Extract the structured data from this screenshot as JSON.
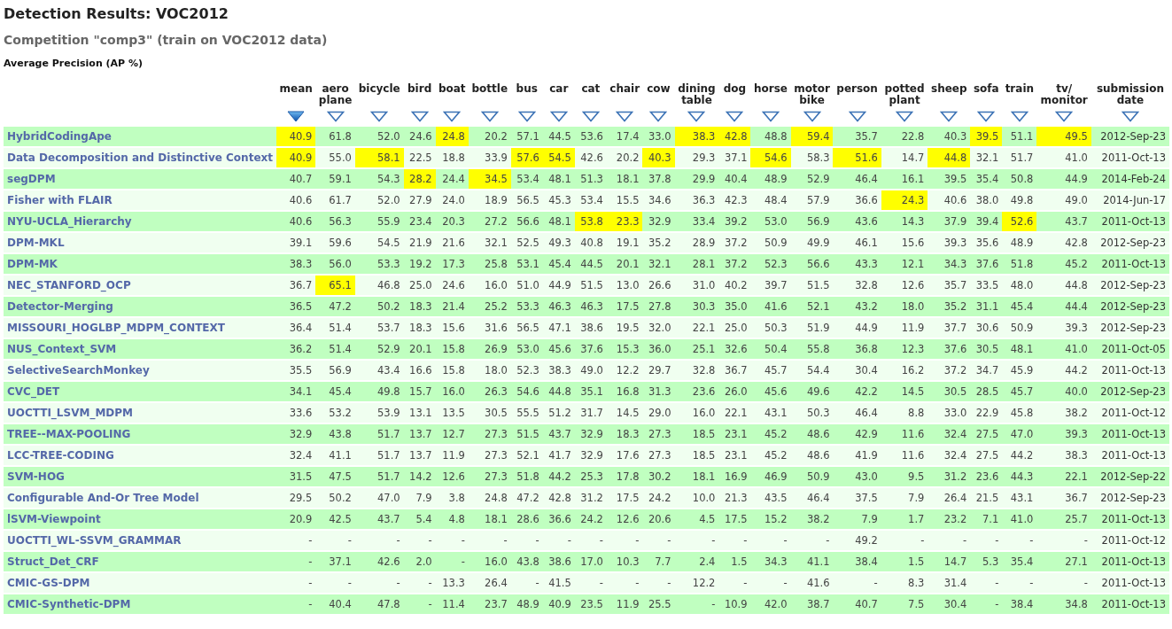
{
  "title": "Detection Results: VOC2012",
  "subtitle": "Competition \"comp3\" (train on VOC2012 data)",
  "section": "Average Precision (AP %)",
  "columns": [
    {
      "label": "mean",
      "sorted": true
    },
    {
      "label": "aero plane",
      "sorted": false
    },
    {
      "label": "bicycle",
      "sorted": false
    },
    {
      "label": "bird",
      "sorted": false
    },
    {
      "label": "boat",
      "sorted": false
    },
    {
      "label": "bottle",
      "sorted": false
    },
    {
      "label": "bus",
      "sorted": false
    },
    {
      "label": "car",
      "sorted": false
    },
    {
      "label": "cat",
      "sorted": false
    },
    {
      "label": "chair",
      "sorted": false
    },
    {
      "label": "cow",
      "sorted": false
    },
    {
      "label": "dining table",
      "sorted": false
    },
    {
      "label": "dog",
      "sorted": false
    },
    {
      "label": "horse",
      "sorted": false
    },
    {
      "label": "motor bike",
      "sorted": false
    },
    {
      "label": "person",
      "sorted": false
    },
    {
      "label": "potted plant",
      "sorted": false
    },
    {
      "label": "sheep",
      "sorted": false
    },
    {
      "label": "sofa",
      "sorted": false
    },
    {
      "label": "train",
      "sorted": false
    },
    {
      "label": "tv/ monitor",
      "sorted": false
    },
    {
      "label": "submission date",
      "sorted": false
    }
  ],
  "rows": [
    {
      "name": "HybridCodingApe",
      "date": "2012-Sep-23",
      "cells": [
        {
          "value": "40.9",
          "best": true
        },
        {
          "value": "61.8",
          "best": false
        },
        {
          "value": "52.0",
          "best": false
        },
        {
          "value": "24.6",
          "best": false
        },
        {
          "value": "24.8",
          "best": true
        },
        {
          "value": "20.2",
          "best": false
        },
        {
          "value": "57.1",
          "best": false
        },
        {
          "value": "44.5",
          "best": false
        },
        {
          "value": "53.6",
          "best": false
        },
        {
          "value": "17.4",
          "best": false
        },
        {
          "value": "33.0",
          "best": false
        },
        {
          "value": "38.3",
          "best": true
        },
        {
          "value": "42.8",
          "best": true
        },
        {
          "value": "48.8",
          "best": false
        },
        {
          "value": "59.4",
          "best": true
        },
        {
          "value": "35.7",
          "best": false
        },
        {
          "value": "22.8",
          "best": false
        },
        {
          "value": "40.3",
          "best": false
        },
        {
          "value": "39.5",
          "best": true
        },
        {
          "value": "51.1",
          "best": false
        },
        {
          "value": "49.5",
          "best": true
        }
      ]
    },
    {
      "name": "Data Decomposition and Distinctive Context",
      "date": "2011-Oct-13",
      "cells": [
        {
          "value": "40.9",
          "best": true
        },
        {
          "value": "55.0",
          "best": false
        },
        {
          "value": "58.1",
          "best": true
        },
        {
          "value": "22.5",
          "best": false
        },
        {
          "value": "18.8",
          "best": false
        },
        {
          "value": "33.9",
          "best": false
        },
        {
          "value": "57.6",
          "best": true
        },
        {
          "value": "54.5",
          "best": true
        },
        {
          "value": "42.6",
          "best": false
        },
        {
          "value": "20.2",
          "best": false
        },
        {
          "value": "40.3",
          "best": true
        },
        {
          "value": "29.3",
          "best": false
        },
        {
          "value": "37.1",
          "best": false
        },
        {
          "value": "54.6",
          "best": true
        },
        {
          "value": "58.3",
          "best": false
        },
        {
          "value": "51.6",
          "best": true
        },
        {
          "value": "14.7",
          "best": false
        },
        {
          "value": "44.8",
          "best": true
        },
        {
          "value": "32.1",
          "best": false
        },
        {
          "value": "51.7",
          "best": false
        },
        {
          "value": "41.0",
          "best": false
        }
      ]
    },
    {
      "name": "segDPM",
      "date": "2014-Feb-24",
      "cells": [
        {
          "value": "40.7",
          "best": false
        },
        {
          "value": "59.1",
          "best": false
        },
        {
          "value": "54.3",
          "best": false
        },
        {
          "value": "28.2",
          "best": true
        },
        {
          "value": "24.4",
          "best": false
        },
        {
          "value": "34.5",
          "best": true
        },
        {
          "value": "53.4",
          "best": false
        },
        {
          "value": "48.1",
          "best": false
        },
        {
          "value": "51.3",
          "best": false
        },
        {
          "value": "18.1",
          "best": false
        },
        {
          "value": "37.8",
          "best": false
        },
        {
          "value": "29.9",
          "best": false
        },
        {
          "value": "40.4",
          "best": false
        },
        {
          "value": "48.9",
          "best": false
        },
        {
          "value": "52.9",
          "best": false
        },
        {
          "value": "46.4",
          "best": false
        },
        {
          "value": "16.1",
          "best": false
        },
        {
          "value": "39.5",
          "best": false
        },
        {
          "value": "35.4",
          "best": false
        },
        {
          "value": "50.8",
          "best": false
        },
        {
          "value": "44.9",
          "best": false
        }
      ]
    },
    {
      "name": "Fisher with FLAIR",
      "date": "2014-Jun-17",
      "cells": [
        {
          "value": "40.6",
          "best": false
        },
        {
          "value": "61.7",
          "best": false
        },
        {
          "value": "52.0",
          "best": false
        },
        {
          "value": "27.9",
          "best": false
        },
        {
          "value": "24.0",
          "best": false
        },
        {
          "value": "18.9",
          "best": false
        },
        {
          "value": "56.5",
          "best": false
        },
        {
          "value": "45.3",
          "best": false
        },
        {
          "value": "53.4",
          "best": false
        },
        {
          "value": "15.5",
          "best": false
        },
        {
          "value": "34.6",
          "best": false
        },
        {
          "value": "36.3",
          "best": false
        },
        {
          "value": "42.3",
          "best": false
        },
        {
          "value": "48.4",
          "best": false
        },
        {
          "value": "57.9",
          "best": false
        },
        {
          "value": "36.6",
          "best": false
        },
        {
          "value": "24.3",
          "best": true
        },
        {
          "value": "40.6",
          "best": false
        },
        {
          "value": "38.0",
          "best": false
        },
        {
          "value": "49.8",
          "best": false
        },
        {
          "value": "49.0",
          "best": false
        }
      ]
    },
    {
      "name": "NYU-UCLA_Hierarchy",
      "date": "2011-Oct-13",
      "cells": [
        {
          "value": "40.6",
          "best": false
        },
        {
          "value": "56.3",
          "best": false
        },
        {
          "value": "55.9",
          "best": false
        },
        {
          "value": "23.4",
          "best": false
        },
        {
          "value": "20.3",
          "best": false
        },
        {
          "value": "27.2",
          "best": false
        },
        {
          "value": "56.6",
          "best": false
        },
        {
          "value": "48.1",
          "best": false
        },
        {
          "value": "53.8",
          "best": true
        },
        {
          "value": "23.3",
          "best": true
        },
        {
          "value": "32.9",
          "best": false
        },
        {
          "value": "33.4",
          "best": false
        },
        {
          "value": "39.2",
          "best": false
        },
        {
          "value": "53.0",
          "best": false
        },
        {
          "value": "56.9",
          "best": false
        },
        {
          "value": "43.6",
          "best": false
        },
        {
          "value": "14.3",
          "best": false
        },
        {
          "value": "37.9",
          "best": false
        },
        {
          "value": "39.4",
          "best": false
        },
        {
          "value": "52.6",
          "best": true
        },
        {
          "value": "43.7",
          "best": false
        }
      ]
    },
    {
      "name": "DPM-MKL",
      "date": "2012-Sep-23",
      "cells": [
        {
          "value": "39.1",
          "best": false
        },
        {
          "value": "59.6",
          "best": false
        },
        {
          "value": "54.5",
          "best": false
        },
        {
          "value": "21.9",
          "best": false
        },
        {
          "value": "21.6",
          "best": false
        },
        {
          "value": "32.1",
          "best": false
        },
        {
          "value": "52.5",
          "best": false
        },
        {
          "value": "49.3",
          "best": false
        },
        {
          "value": "40.8",
          "best": false
        },
        {
          "value": "19.1",
          "best": false
        },
        {
          "value": "35.2",
          "best": false
        },
        {
          "value": "28.9",
          "best": false
        },
        {
          "value": "37.2",
          "best": false
        },
        {
          "value": "50.9",
          "best": false
        },
        {
          "value": "49.9",
          "best": false
        },
        {
          "value": "46.1",
          "best": false
        },
        {
          "value": "15.6",
          "best": false
        },
        {
          "value": "39.3",
          "best": false
        },
        {
          "value": "35.6",
          "best": false
        },
        {
          "value": "48.9",
          "best": false
        },
        {
          "value": "42.8",
          "best": false
        }
      ]
    },
    {
      "name": "DPM-MK",
      "date": "2011-Oct-13",
      "cells": [
        {
          "value": "38.3",
          "best": false
        },
        {
          "value": "56.0",
          "best": false
        },
        {
          "value": "53.3",
          "best": false
        },
        {
          "value": "19.2",
          "best": false
        },
        {
          "value": "17.3",
          "best": false
        },
        {
          "value": "25.8",
          "best": false
        },
        {
          "value": "53.1",
          "best": false
        },
        {
          "value": "45.4",
          "best": false
        },
        {
          "value": "44.5",
          "best": false
        },
        {
          "value": "20.1",
          "best": false
        },
        {
          "value": "32.1",
          "best": false
        },
        {
          "value": "28.1",
          "best": false
        },
        {
          "value": "37.2",
          "best": false
        },
        {
          "value": "52.3",
          "best": false
        },
        {
          "value": "56.6",
          "best": false
        },
        {
          "value": "43.3",
          "best": false
        },
        {
          "value": "12.1",
          "best": false
        },
        {
          "value": "34.3",
          "best": false
        },
        {
          "value": "37.6",
          "best": false
        },
        {
          "value": "51.8",
          "best": false
        },
        {
          "value": "45.2",
          "best": false
        }
      ]
    },
    {
      "name": "NEC_STANFORD_OCP",
      "date": "2012-Sep-23",
      "cells": [
        {
          "value": "36.7",
          "best": false
        },
        {
          "value": "65.1",
          "best": true
        },
        {
          "value": "46.8",
          "best": false
        },
        {
          "value": "25.0",
          "best": false
        },
        {
          "value": "24.6",
          "best": false
        },
        {
          "value": "16.0",
          "best": false
        },
        {
          "value": "51.0",
          "best": false
        },
        {
          "value": "44.9",
          "best": false
        },
        {
          "value": "51.5",
          "best": false
        },
        {
          "value": "13.0",
          "best": false
        },
        {
          "value": "26.6",
          "best": false
        },
        {
          "value": "31.0",
          "best": false
        },
        {
          "value": "40.2",
          "best": false
        },
        {
          "value": "39.7",
          "best": false
        },
        {
          "value": "51.5",
          "best": false
        },
        {
          "value": "32.8",
          "best": false
        },
        {
          "value": "12.6",
          "best": false
        },
        {
          "value": "35.7",
          "best": false
        },
        {
          "value": "33.5",
          "best": false
        },
        {
          "value": "48.0",
          "best": false
        },
        {
          "value": "44.8",
          "best": false
        }
      ]
    },
    {
      "name": "Detector-Merging",
      "date": "2012-Sep-23",
      "cells": [
        {
          "value": "36.5",
          "best": false
        },
        {
          "value": "47.2",
          "best": false
        },
        {
          "value": "50.2",
          "best": false
        },
        {
          "value": "18.3",
          "best": false
        },
        {
          "value": "21.4",
          "best": false
        },
        {
          "value": "25.2",
          "best": false
        },
        {
          "value": "53.3",
          "best": false
        },
        {
          "value": "46.3",
          "best": false
        },
        {
          "value": "46.3",
          "best": false
        },
        {
          "value": "17.5",
          "best": false
        },
        {
          "value": "27.8",
          "best": false
        },
        {
          "value": "30.3",
          "best": false
        },
        {
          "value": "35.0",
          "best": false
        },
        {
          "value": "41.6",
          "best": false
        },
        {
          "value": "52.1",
          "best": false
        },
        {
          "value": "43.2",
          "best": false
        },
        {
          "value": "18.0",
          "best": false
        },
        {
          "value": "35.2",
          "best": false
        },
        {
          "value": "31.1",
          "best": false
        },
        {
          "value": "45.4",
          "best": false
        },
        {
          "value": "44.4",
          "best": false
        }
      ]
    },
    {
      "name": "MISSOURI_HOGLBP_MDPM_CONTEXT",
      "date": "2012-Sep-23",
      "cells": [
        {
          "value": "36.4",
          "best": false
        },
        {
          "value": "51.4",
          "best": false
        },
        {
          "value": "53.7",
          "best": false
        },
        {
          "value": "18.3",
          "best": false
        },
        {
          "value": "15.6",
          "best": false
        },
        {
          "value": "31.6",
          "best": false
        },
        {
          "value": "56.5",
          "best": false
        },
        {
          "value": "47.1",
          "best": false
        },
        {
          "value": "38.6",
          "best": false
        },
        {
          "value": "19.5",
          "best": false
        },
        {
          "value": "32.0",
          "best": false
        },
        {
          "value": "22.1",
          "best": false
        },
        {
          "value": "25.0",
          "best": false
        },
        {
          "value": "50.3",
          "best": false
        },
        {
          "value": "51.9",
          "best": false
        },
        {
          "value": "44.9",
          "best": false
        },
        {
          "value": "11.9",
          "best": false
        },
        {
          "value": "37.7",
          "best": false
        },
        {
          "value": "30.6",
          "best": false
        },
        {
          "value": "50.9",
          "best": false
        },
        {
          "value": "39.3",
          "best": false
        }
      ]
    },
    {
      "name": "NUS_Context_SVM",
      "date": "2011-Oct-05",
      "cells": [
        {
          "value": "36.2",
          "best": false
        },
        {
          "value": "51.4",
          "best": false
        },
        {
          "value": "52.9",
          "best": false
        },
        {
          "value": "20.1",
          "best": false
        },
        {
          "value": "15.8",
          "best": false
        },
        {
          "value": "26.9",
          "best": false
        },
        {
          "value": "53.0",
          "best": false
        },
        {
          "value": "45.6",
          "best": false
        },
        {
          "value": "37.6",
          "best": false
        },
        {
          "value": "15.3",
          "best": false
        },
        {
          "value": "36.0",
          "best": false
        },
        {
          "value": "25.1",
          "best": false
        },
        {
          "value": "32.6",
          "best": false
        },
        {
          "value": "50.4",
          "best": false
        },
        {
          "value": "55.8",
          "best": false
        },
        {
          "value": "36.8",
          "best": false
        },
        {
          "value": "12.3",
          "best": false
        },
        {
          "value": "37.6",
          "best": false
        },
        {
          "value": "30.5",
          "best": false
        },
        {
          "value": "48.1",
          "best": false
        },
        {
          "value": "41.0",
          "best": false
        }
      ]
    },
    {
      "name": "SelectiveSearchMonkey",
      "date": "2011-Oct-13",
      "cells": [
        {
          "value": "35.5",
          "best": false
        },
        {
          "value": "56.9",
          "best": false
        },
        {
          "value": "43.4",
          "best": false
        },
        {
          "value": "16.6",
          "best": false
        },
        {
          "value": "15.8",
          "best": false
        },
        {
          "value": "18.0",
          "best": false
        },
        {
          "value": "52.3",
          "best": false
        },
        {
          "value": "38.3",
          "best": false
        },
        {
          "value": "49.0",
          "best": false
        },
        {
          "value": "12.2",
          "best": false
        },
        {
          "value": "29.7",
          "best": false
        },
        {
          "value": "32.8",
          "best": false
        },
        {
          "value": "36.7",
          "best": false
        },
        {
          "value": "45.7",
          "best": false
        },
        {
          "value": "54.4",
          "best": false
        },
        {
          "value": "30.4",
          "best": false
        },
        {
          "value": "16.2",
          "best": false
        },
        {
          "value": "37.2",
          "best": false
        },
        {
          "value": "34.7",
          "best": false
        },
        {
          "value": "45.9",
          "best": false
        },
        {
          "value": "44.2",
          "best": false
        }
      ]
    },
    {
      "name": "CVC_DET",
      "date": "2012-Sep-23",
      "cells": [
        {
          "value": "34.1",
          "best": false
        },
        {
          "value": "45.4",
          "best": false
        },
        {
          "value": "49.8",
          "best": false
        },
        {
          "value": "15.7",
          "best": false
        },
        {
          "value": "16.0",
          "best": false
        },
        {
          "value": "26.3",
          "best": false
        },
        {
          "value": "54.6",
          "best": false
        },
        {
          "value": "44.8",
          "best": false
        },
        {
          "value": "35.1",
          "best": false
        },
        {
          "value": "16.8",
          "best": false
        },
        {
          "value": "31.3",
          "best": false
        },
        {
          "value": "23.6",
          "best": false
        },
        {
          "value": "26.0",
          "best": false
        },
        {
          "value": "45.6",
          "best": false
        },
        {
          "value": "49.6",
          "best": false
        },
        {
          "value": "42.2",
          "best": false
        },
        {
          "value": "14.5",
          "best": false
        },
        {
          "value": "30.5",
          "best": false
        },
        {
          "value": "28.5",
          "best": false
        },
        {
          "value": "45.7",
          "best": false
        },
        {
          "value": "40.0",
          "best": false
        }
      ]
    },
    {
      "name": "UOCTTI_LSVM_MDPM",
      "date": "2011-Oct-12",
      "cells": [
        {
          "value": "33.6",
          "best": false
        },
        {
          "value": "53.2",
          "best": false
        },
        {
          "value": "53.9",
          "best": false
        },
        {
          "value": "13.1",
          "best": false
        },
        {
          "value": "13.5",
          "best": false
        },
        {
          "value": "30.5",
          "best": false
        },
        {
          "value": "55.5",
          "best": false
        },
        {
          "value": "51.2",
          "best": false
        },
        {
          "value": "31.7",
          "best": false
        },
        {
          "value": "14.5",
          "best": false
        },
        {
          "value": "29.0",
          "best": false
        },
        {
          "value": "16.0",
          "best": false
        },
        {
          "value": "22.1",
          "best": false
        },
        {
          "value": "43.1",
          "best": false
        },
        {
          "value": "50.3",
          "best": false
        },
        {
          "value": "46.4",
          "best": false
        },
        {
          "value": "8.8",
          "best": false
        },
        {
          "value": "33.0",
          "best": false
        },
        {
          "value": "22.9",
          "best": false
        },
        {
          "value": "45.8",
          "best": false
        },
        {
          "value": "38.2",
          "best": false
        }
      ]
    },
    {
      "name": "TREE--MAX-POOLING",
      "date": "2011-Oct-13",
      "cells": [
        {
          "value": "32.9",
          "best": false
        },
        {
          "value": "43.8",
          "best": false
        },
        {
          "value": "51.7",
          "best": false
        },
        {
          "value": "13.7",
          "best": false
        },
        {
          "value": "12.7",
          "best": false
        },
        {
          "value": "27.3",
          "best": false
        },
        {
          "value": "51.5",
          "best": false
        },
        {
          "value": "43.7",
          "best": false
        },
        {
          "value": "32.9",
          "best": false
        },
        {
          "value": "18.3",
          "best": false
        },
        {
          "value": "27.3",
          "best": false
        },
        {
          "value": "18.5",
          "best": false
        },
        {
          "value": "23.1",
          "best": false
        },
        {
          "value": "45.2",
          "best": false
        },
        {
          "value": "48.6",
          "best": false
        },
        {
          "value": "42.9",
          "best": false
        },
        {
          "value": "11.6",
          "best": false
        },
        {
          "value": "32.4",
          "best": false
        },
        {
          "value": "27.5",
          "best": false
        },
        {
          "value": "47.0",
          "best": false
        },
        {
          "value": "39.3",
          "best": false
        }
      ]
    },
    {
      "name": "LCC-TREE-CODING",
      "date": "2011-Oct-13",
      "cells": [
        {
          "value": "32.4",
          "best": false
        },
        {
          "value": "41.1",
          "best": false
        },
        {
          "value": "51.7",
          "best": false
        },
        {
          "value": "13.7",
          "best": false
        },
        {
          "value": "11.9",
          "best": false
        },
        {
          "value": "27.3",
          "best": false
        },
        {
          "value": "52.1",
          "best": false
        },
        {
          "value": "41.7",
          "best": false
        },
        {
          "value": "32.9",
          "best": false
        },
        {
          "value": "17.6",
          "best": false
        },
        {
          "value": "27.3",
          "best": false
        },
        {
          "value": "18.5",
          "best": false
        },
        {
          "value": "23.1",
          "best": false
        },
        {
          "value": "45.2",
          "best": false
        },
        {
          "value": "48.6",
          "best": false
        },
        {
          "value": "41.9",
          "best": false
        },
        {
          "value": "11.6",
          "best": false
        },
        {
          "value": "32.4",
          "best": false
        },
        {
          "value": "27.5",
          "best": false
        },
        {
          "value": "44.2",
          "best": false
        },
        {
          "value": "38.3",
          "best": false
        }
      ]
    },
    {
      "name": "SVM-HOG",
      "date": "2012-Sep-22",
      "cells": [
        {
          "value": "31.5",
          "best": false
        },
        {
          "value": "47.5",
          "best": false
        },
        {
          "value": "51.7",
          "best": false
        },
        {
          "value": "14.2",
          "best": false
        },
        {
          "value": "12.6",
          "best": false
        },
        {
          "value": "27.3",
          "best": false
        },
        {
          "value": "51.8",
          "best": false
        },
        {
          "value": "44.2",
          "best": false
        },
        {
          "value": "25.3",
          "best": false
        },
        {
          "value": "17.8",
          "best": false
        },
        {
          "value": "30.2",
          "best": false
        },
        {
          "value": "18.1",
          "best": false
        },
        {
          "value": "16.9",
          "best": false
        },
        {
          "value": "46.9",
          "best": false
        },
        {
          "value": "50.9",
          "best": false
        },
        {
          "value": "43.0",
          "best": false
        },
        {
          "value": "9.5",
          "best": false
        },
        {
          "value": "31.2",
          "best": false
        },
        {
          "value": "23.6",
          "best": false
        },
        {
          "value": "44.3",
          "best": false
        },
        {
          "value": "22.1",
          "best": false
        }
      ]
    },
    {
      "name": "Configurable And-Or Tree Model",
      "date": "2012-Sep-23",
      "cells": [
        {
          "value": "29.5",
          "best": false
        },
        {
          "value": "50.2",
          "best": false
        },
        {
          "value": "47.0",
          "best": false
        },
        {
          "value": "7.9",
          "best": false
        },
        {
          "value": "3.8",
          "best": false
        },
        {
          "value": "24.8",
          "best": false
        },
        {
          "value": "47.2",
          "best": false
        },
        {
          "value": "42.8",
          "best": false
        },
        {
          "value": "31.2",
          "best": false
        },
        {
          "value": "17.5",
          "best": false
        },
        {
          "value": "24.2",
          "best": false
        },
        {
          "value": "10.0",
          "best": false
        },
        {
          "value": "21.3",
          "best": false
        },
        {
          "value": "43.5",
          "best": false
        },
        {
          "value": "46.4",
          "best": false
        },
        {
          "value": "37.5",
          "best": false
        },
        {
          "value": "7.9",
          "best": false
        },
        {
          "value": "26.4",
          "best": false
        },
        {
          "value": "21.5",
          "best": false
        },
        {
          "value": "43.1",
          "best": false
        },
        {
          "value": "36.7",
          "best": false
        }
      ]
    },
    {
      "name": "lSVM-Viewpoint",
      "date": "2011-Oct-13",
      "cells": [
        {
          "value": "20.9",
          "best": false
        },
        {
          "value": "42.5",
          "best": false
        },
        {
          "value": "43.7",
          "best": false
        },
        {
          "value": "5.4",
          "best": false
        },
        {
          "value": "4.8",
          "best": false
        },
        {
          "value": "18.1",
          "best": false
        },
        {
          "value": "28.6",
          "best": false
        },
        {
          "value": "36.6",
          "best": false
        },
        {
          "value": "24.2",
          "best": false
        },
        {
          "value": "12.6",
          "best": false
        },
        {
          "value": "20.6",
          "best": false
        },
        {
          "value": "4.5",
          "best": false
        },
        {
          "value": "17.5",
          "best": false
        },
        {
          "value": "15.2",
          "best": false
        },
        {
          "value": "38.2",
          "best": false
        },
        {
          "value": "7.9",
          "best": false
        },
        {
          "value": "1.7",
          "best": false
        },
        {
          "value": "23.2",
          "best": false
        },
        {
          "value": "7.1",
          "best": false
        },
        {
          "value": "41.0",
          "best": false
        },
        {
          "value": "25.7",
          "best": false
        }
      ]
    },
    {
      "name": "UOCTTI_WL-SSVM_GRAMMAR",
      "date": "2011-Oct-12",
      "cells": [
        {
          "value": "-",
          "best": false
        },
        {
          "value": "-",
          "best": false
        },
        {
          "value": "-",
          "best": false
        },
        {
          "value": "-",
          "best": false
        },
        {
          "value": "-",
          "best": false
        },
        {
          "value": "-",
          "best": false
        },
        {
          "value": "-",
          "best": false
        },
        {
          "value": "-",
          "best": false
        },
        {
          "value": "-",
          "best": false
        },
        {
          "value": "-",
          "best": false
        },
        {
          "value": "-",
          "best": false
        },
        {
          "value": "-",
          "best": false
        },
        {
          "value": "-",
          "best": false
        },
        {
          "value": "-",
          "best": false
        },
        {
          "value": "-",
          "best": false
        },
        {
          "value": "49.2",
          "best": false
        },
        {
          "value": "-",
          "best": false
        },
        {
          "value": "-",
          "best": false
        },
        {
          "value": "-",
          "best": false
        },
        {
          "value": "-",
          "best": false
        },
        {
          "value": "-",
          "best": false
        }
      ]
    },
    {
      "name": "Struct_Det_CRF",
      "date": "2011-Oct-13",
      "cells": [
        {
          "value": "-",
          "best": false
        },
        {
          "value": "37.1",
          "best": false
        },
        {
          "value": "42.6",
          "best": false
        },
        {
          "value": "2.0",
          "best": false
        },
        {
          "value": "-",
          "best": false
        },
        {
          "value": "16.0",
          "best": false
        },
        {
          "value": "43.8",
          "best": false
        },
        {
          "value": "38.6",
          "best": false
        },
        {
          "value": "17.0",
          "best": false
        },
        {
          "value": "10.3",
          "best": false
        },
        {
          "value": "7.7",
          "best": false
        },
        {
          "value": "2.4",
          "best": false
        },
        {
          "value": "1.5",
          "best": false
        },
        {
          "value": "34.3",
          "best": false
        },
        {
          "value": "41.1",
          "best": false
        },
        {
          "value": "38.4",
          "best": false
        },
        {
          "value": "1.5",
          "best": false
        },
        {
          "value": "14.7",
          "best": false
        },
        {
          "value": "5.3",
          "best": false
        },
        {
          "value": "35.4",
          "best": false
        },
        {
          "value": "27.1",
          "best": false
        }
      ]
    },
    {
      "name": "CMIC-GS-DPM",
      "date": "2011-Oct-13",
      "cells": [
        {
          "value": "-",
          "best": false
        },
        {
          "value": "-",
          "best": false
        },
        {
          "value": "-",
          "best": false
        },
        {
          "value": "-",
          "best": false
        },
        {
          "value": "13.3",
          "best": false
        },
        {
          "value": "26.4",
          "best": false
        },
        {
          "value": "-",
          "best": false
        },
        {
          "value": "41.5",
          "best": false
        },
        {
          "value": "-",
          "best": false
        },
        {
          "value": "-",
          "best": false
        },
        {
          "value": "-",
          "best": false
        },
        {
          "value": "12.2",
          "best": false
        },
        {
          "value": "-",
          "best": false
        },
        {
          "value": "-",
          "best": false
        },
        {
          "value": "41.6",
          "best": false
        },
        {
          "value": "-",
          "best": false
        },
        {
          "value": "8.3",
          "best": false
        },
        {
          "value": "31.4",
          "best": false
        },
        {
          "value": "-",
          "best": false
        },
        {
          "value": "-",
          "best": false
        },
        {
          "value": "-",
          "best": false
        }
      ]
    },
    {
      "name": "CMIC-Synthetic-DPM",
      "date": "2011-Oct-13",
      "cells": [
        {
          "value": "-",
          "best": false
        },
        {
          "value": "40.4",
          "best": false
        },
        {
          "value": "47.8",
          "best": false
        },
        {
          "value": "-",
          "best": false
        },
        {
          "value": "11.4",
          "best": false
        },
        {
          "value": "23.7",
          "best": false
        },
        {
          "value": "48.9",
          "best": false
        },
        {
          "value": "40.9",
          "best": false
        },
        {
          "value": "23.5",
          "best": false
        },
        {
          "value": "11.9",
          "best": false
        },
        {
          "value": "25.5",
          "best": false
        },
        {
          "value": "-",
          "best": false
        },
        {
          "value": "10.9",
          "best": false
        },
        {
          "value": "42.0",
          "best": false
        },
        {
          "value": "38.7",
          "best": false
        },
        {
          "value": "40.7",
          "best": false
        },
        {
          "value": "7.5",
          "best": false
        },
        {
          "value": "30.4",
          "best": false
        },
        {
          "value": "-",
          "best": false
        },
        {
          "value": "38.4",
          "best": false
        },
        {
          "value": "34.8",
          "best": false
        }
      ]
    }
  ]
}
